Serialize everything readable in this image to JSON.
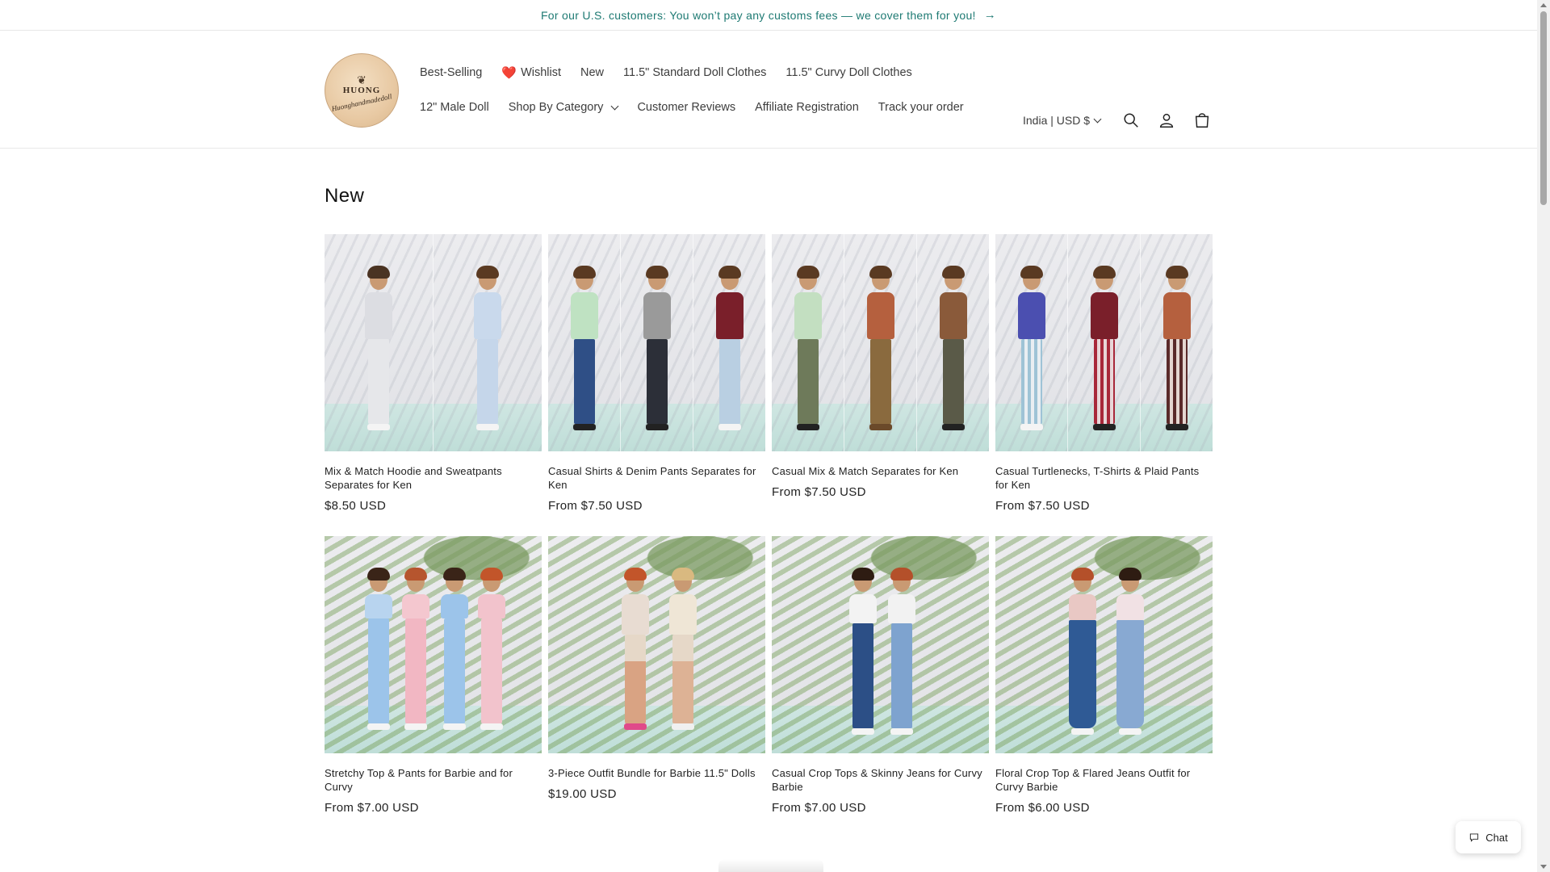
{
  "announcement": {
    "text": "For our U.S. customers: You won’t pay any customs fees — we cover them for you!",
    "arrow": "→"
  },
  "logo": {
    "brand": "HUONG",
    "script": "Huonghandmadedoll",
    "icon": "leaf-ornament-icon"
  },
  "nav": {
    "row1": [
      {
        "label": "Best-Selling"
      },
      {
        "label": "Wishlist",
        "icon": "heart-icon",
        "glyph": "❤️"
      },
      {
        "label": "New"
      },
      {
        "label": "11.5\" Standard Doll Clothes"
      },
      {
        "label": "11.5\" Curvy Doll Clothes"
      }
    ],
    "row2": [
      {
        "label": "12\" Male Doll"
      },
      {
        "label": "Shop By Category",
        "dropdown": true
      },
      {
        "label": "Customer Reviews"
      },
      {
        "label": "Affiliate Registration"
      },
      {
        "label": "Track your order"
      }
    ]
  },
  "header_right": {
    "locale": "India | USD $",
    "icons": [
      "search-icon",
      "account-icon",
      "cart-icon"
    ]
  },
  "section": {
    "title": "New"
  },
  "products": [
    {
      "title": "Mix & Match Hoodie and Sweatpants Separates for Ken",
      "price": "$8.50 USD"
    },
    {
      "title": "Casual Shirts & Denim Pants Separates for Ken",
      "price": "From $7.50 USD"
    },
    {
      "title": "Casual Mix & Match Separates for Ken",
      "price": "From $7.50 USD"
    },
    {
      "title": "Casual Turtlenecks, T-Shirts & Plaid Pants for Ken",
      "price": "From $7.50 USD"
    },
    {
      "title": "Stretchy Top & Pants for Barbie and for Curvy",
      "price": "From $7.00 USD"
    },
    {
      "title": "3-Piece Outfit Bundle for Barbie 11.5\" Dolls",
      "price": "$19.00 USD"
    },
    {
      "title": "Casual Crop Tops & Skinny Jeans for Curvy Barbie",
      "price": "From $7.00 USD"
    },
    {
      "title": "Floral Crop Top & Flared Jeans Outfit for Curvy Barbie",
      "price": "From $6.00 USD"
    }
  ],
  "chat": {
    "label": "Chat",
    "icon": "chat-bubble-icon"
  },
  "colors": {
    "announcement_text": "#1e7a73",
    "text": "#121212",
    "border": "#e8e8e8"
  }
}
